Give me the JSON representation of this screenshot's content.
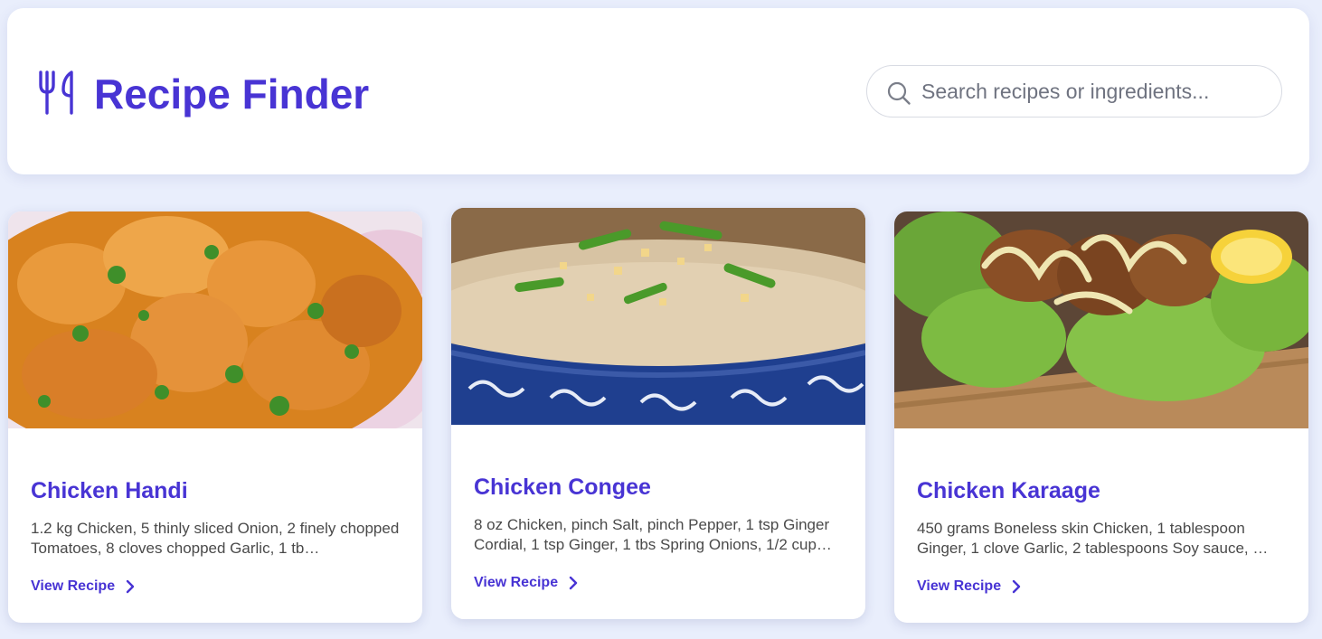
{
  "header": {
    "logo_icon": "fork-knife-icon",
    "title": "Recipe Finder",
    "brand_color": "#4834d4"
  },
  "search": {
    "icon": "search-icon",
    "placeholder": "Search recipes or ingredients...",
    "value": ""
  },
  "recipes": [
    {
      "name": "Chicken Handi",
      "ingredients": "1.2 kg Chicken, 5 thinly sliced Onion, 2 finely chopped Tomatoes, 8 cloves chopped Garlic, 1 tb…",
      "link_label": "View Recipe",
      "link_icon": "chevron-right-icon",
      "image": "chicken-handi-photo"
    },
    {
      "name": "Chicken Congee",
      "ingredients": "8 oz Chicken, pinch Salt, pinch Pepper, 1 tsp Ginger Cordial, 1 tsp Ginger, 1 tbs Spring Onions, 1/2 cup…",
      "link_label": "View Recipe",
      "link_icon": "chevron-right-icon",
      "image": "chicken-congee-photo"
    },
    {
      "name": "Chicken Karaage",
      "ingredients": "450 grams Boneless skin Chicken, 1 tablespoon Ginger, 1 clove Garlic, 2 tablespoons Soy sauce, …",
      "link_label": "View Recipe",
      "link_icon": "chevron-right-icon",
      "image": "chicken-karaage-photo"
    }
  ]
}
